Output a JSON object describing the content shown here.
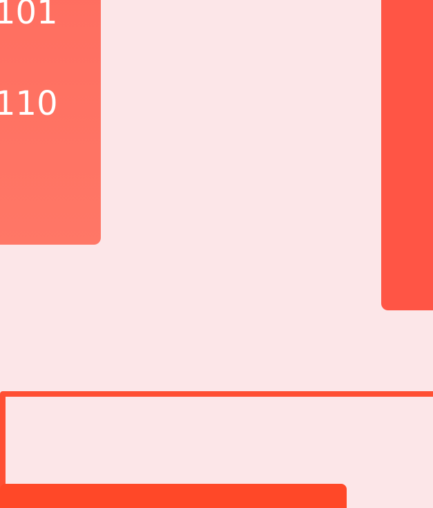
{
  "app": {
    "background": "#FCE6E8"
  },
  "cards": {
    "left": {
      "top_text": "101",
      "bottom_text": "110",
      "color": "#FF7060"
    },
    "right": {
      "color": "#FF5545"
    }
  },
  "outline_box": {
    "color": "#FF4F33"
  },
  "bottom_bar": {
    "color": "#FF4828"
  }
}
